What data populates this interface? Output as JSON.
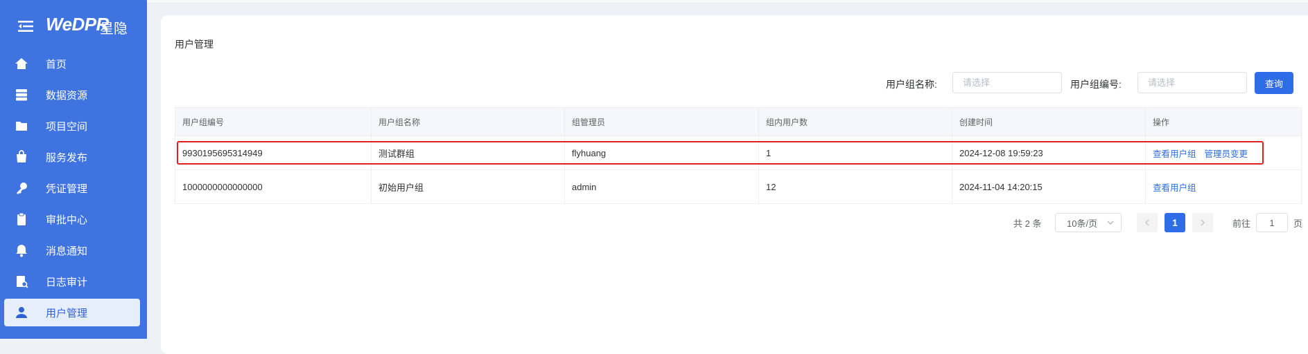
{
  "brand": {
    "logo": "WeDPR",
    "logo_cn": "星隐"
  },
  "nav": [
    {
      "label": "首页",
      "icon": "home-icon"
    },
    {
      "label": "数据资源",
      "icon": "database-icon"
    },
    {
      "label": "项目空间",
      "icon": "folder-icon"
    },
    {
      "label": "服务发布",
      "icon": "bag-icon"
    },
    {
      "label": "凭证管理",
      "icon": "key-icon"
    },
    {
      "label": "审批中心",
      "icon": "clipboard-icon"
    },
    {
      "label": "消息通知",
      "icon": "bell-icon"
    },
    {
      "label": "日志审计",
      "icon": "log-icon"
    },
    {
      "label": "用户管理",
      "icon": "user-icon",
      "active": true
    }
  ],
  "page": {
    "title": "用户管理"
  },
  "filters": {
    "group_name_label": "用户组名称:",
    "group_name_placeholder": "请选择",
    "group_id_label": "用户组编号:",
    "group_id_placeholder": "请选择",
    "query_label": "查询"
  },
  "table": {
    "headers": [
      "用户组编号",
      "用户组名称",
      "组管理员",
      "组内用户数",
      "创建时间",
      "操作"
    ],
    "rows": [
      {
        "id": "9930195695314949",
        "name": "测试群组",
        "admin": "flyhuang",
        "count": "1",
        "created": "2024-12-08 19:59:23",
        "actions": [
          "查看用户组",
          "管理员变更"
        ]
      },
      {
        "id": "1000000000000000",
        "name": "初始用户组",
        "admin": "admin",
        "count": "12",
        "created": "2024-11-04 14:20:15",
        "actions": [
          "查看用户组"
        ]
      }
    ]
  },
  "pagination": {
    "total": "共 2 条",
    "page_size": "10条/页",
    "current": "1",
    "goto_label": "前往",
    "goto_value": "1",
    "page_suffix": "页"
  }
}
